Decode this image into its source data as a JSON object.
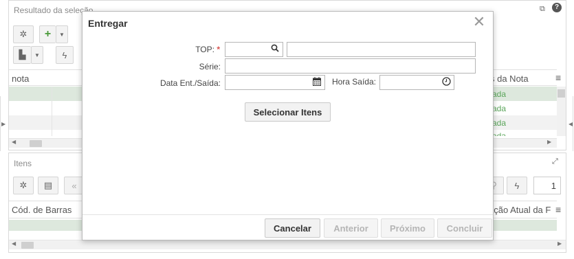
{
  "background": {
    "top_panel": {
      "title": "Resultado da seleção",
      "columns": [
        "nota",
        "s da Nota"
      ],
      "status_values": [
        "ada",
        "ada",
        "ada",
        "ada"
      ]
    },
    "bottom_panel": {
      "title": "Itens",
      "columns": [
        "Cód. de Barras",
        "ação Atual da F"
      ],
      "page_number": "1"
    }
  },
  "modal": {
    "title": "Entregar",
    "close_glyph": "✕",
    "fields": {
      "top_label": "TOP:",
      "top_required": "*",
      "serie_label": "Série:",
      "data_label": "Data Ent./Saída:",
      "hora_label": "Hora Saída:"
    },
    "select_items_label": "Selecionar Itens",
    "footer": {
      "cancel": "Cancelar",
      "previous": "Anterior",
      "next": "Próximo",
      "finish": "Concluir"
    }
  },
  "colors": {
    "accent_green": "#5aa55a",
    "selected_row": "#dde8dd",
    "required": "#d9534f"
  }
}
